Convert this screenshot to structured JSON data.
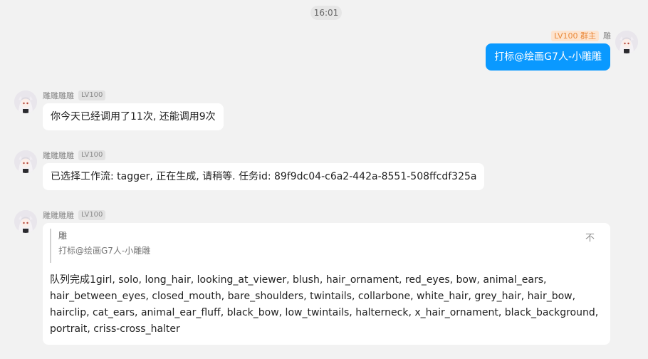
{
  "timestamp": "16:01",
  "outgoing": {
    "badge": "LV100 群主",
    "sender": "雕",
    "text": "打标@绘画G7人-小雕雕"
  },
  "messages": [
    {
      "sender": "雕雕雕雕",
      "level": "LV100",
      "text": "你今天已经调用了11次, 还能调用9次"
    },
    {
      "sender": "雕雕雕雕",
      "level": "LV100",
      "text": "已选择工作流: tagger, 正在生成, 请稍等. 任务id: 89f9dc04-c6a2-442a-8551-508ffcdf325a"
    },
    {
      "sender": "雕雕雕雕",
      "level": "LV100",
      "quote": {
        "sender": "雕",
        "text": "打标@绘画G7人-小雕雕",
        "collapse_label": "不"
      },
      "text": "队列完成1girl, solo, long_hair, looking_at_viewer, blush, hair_ornament, red_eyes, bow, animal_ears, hair_between_eyes, closed_mouth, bare_shoulders, twintails, collarbone, white_hair, grey_hair, hair_bow, hairclip, cat_ears, animal_ear_fluff, black_bow, low_twintails, halterneck, x_hair_ornament, black_background, portrait, criss-cross_halter"
    }
  ],
  "colors": {
    "outgoing_bubble": "#0a99ff",
    "owner_badge_bg": "#fde4cf",
    "owner_badge_text": "#ea8a3a",
    "background": "#f2f2f2"
  },
  "icons": [
    "avatar-icon",
    "collapse-icon"
  ]
}
